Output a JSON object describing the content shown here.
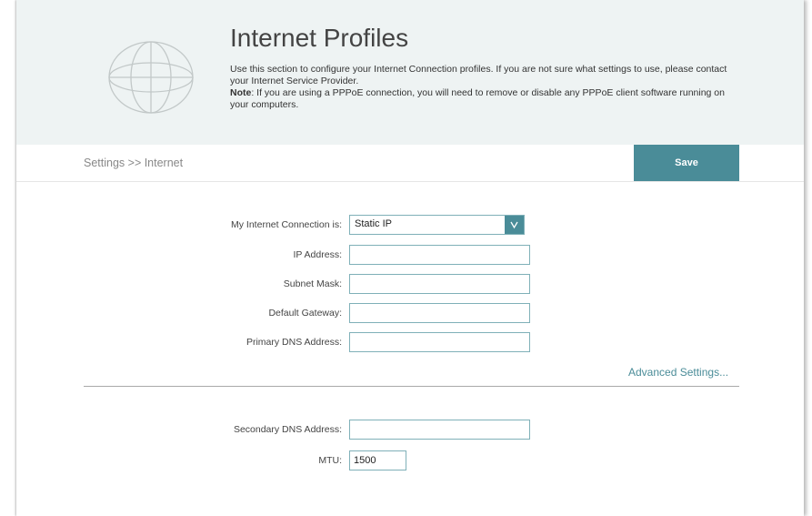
{
  "header": {
    "title": "Internet Profiles",
    "description_line1": "Use this section to configure your Internet Connection profiles. If you are not sure what settings to use, please contact your Internet Service Provider.",
    "note_label": "Note",
    "note_text": ": If you are using a PPPoE connection, you will need to remove or disable any PPPoE client software running on your computers.",
    "icon": "globe-icon"
  },
  "breadcrumb": "Settings >> Internet",
  "toolbar": {
    "save_label": "Save"
  },
  "form": {
    "connection_label": "My Internet Connection is:",
    "connection_value": "Static IP",
    "ip_label": "IP Address:",
    "ip_value": "",
    "subnet_label": "Subnet Mask:",
    "subnet_value": "",
    "gateway_label": "Default Gateway:",
    "gateway_value": "",
    "primary_dns_label": "Primary DNS Address:",
    "primary_dns_value": "",
    "advanced_link": "Advanced Settings...",
    "secondary_dns_label": "Secondary DNS Address:",
    "secondary_dns_value": "",
    "mtu_label": "MTU:",
    "mtu_value": "1500"
  },
  "colors": {
    "accent": "#4a8c98",
    "header_bg": "#eef3f3",
    "input_border": "#7fb0b8"
  }
}
